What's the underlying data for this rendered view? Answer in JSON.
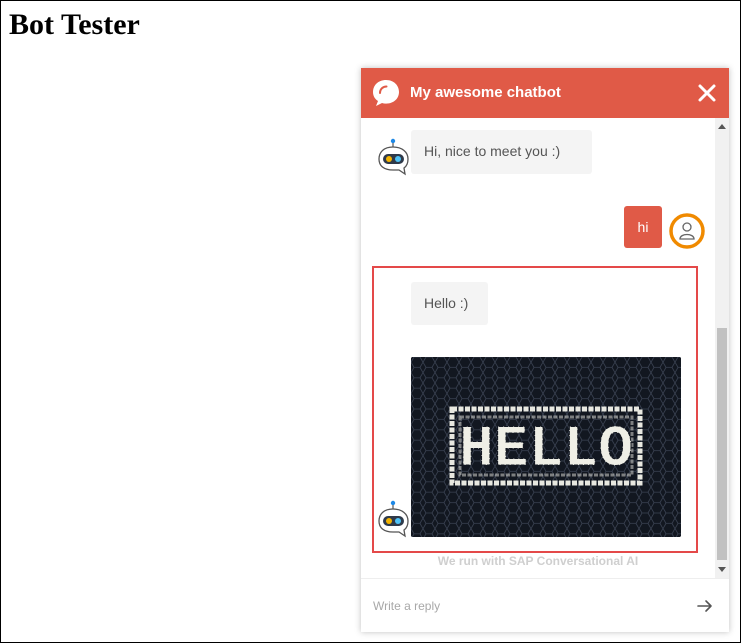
{
  "page": {
    "title": "Bot Tester"
  },
  "chat": {
    "header_title": "My awesome chatbot",
    "accent_color": "#e05a47",
    "messages": [
      {
        "from": "bot",
        "text": "Hi, nice to meet you :)"
      },
      {
        "from": "user",
        "text": "hi"
      },
      {
        "from": "bot",
        "text": "Hello :)"
      },
      {
        "from": "bot",
        "type": "image",
        "image_text": "HELLO"
      }
    ],
    "footer": "We run with SAP Conversational AI",
    "input": {
      "placeholder": "Write a reply",
      "value": ""
    },
    "icons": {
      "logo": "chat-bubble-icon",
      "close": "close-icon",
      "bot_avatar": "robot-icon",
      "user_avatar": "user-icon",
      "send": "arrow-right-icon"
    }
  }
}
